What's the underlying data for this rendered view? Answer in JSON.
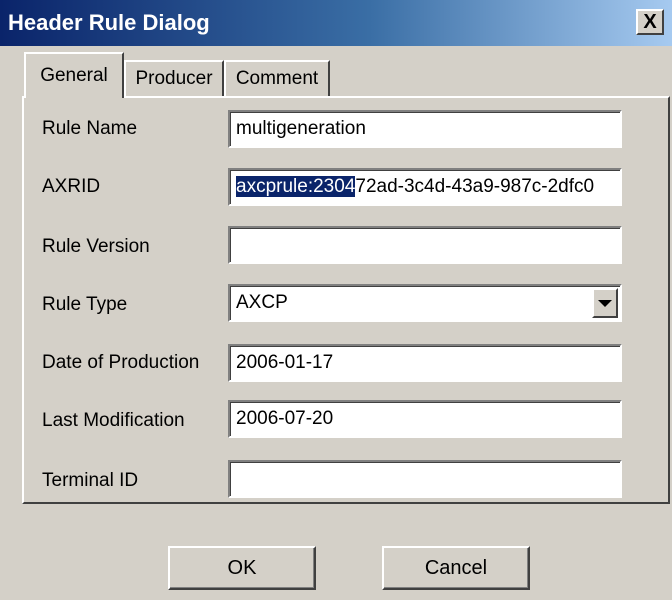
{
  "window": {
    "title": "Header Rule Dialog",
    "close_glyph": "X"
  },
  "tabs": [
    {
      "label": "General",
      "active": true
    },
    {
      "label": "Producer",
      "active": false
    },
    {
      "label": "Comment",
      "active": false
    }
  ],
  "form": {
    "rule_name": {
      "label": "Rule Name",
      "value": "multigeneration"
    },
    "axrid": {
      "label": "AXRID",
      "value_selected": "axcprule:2304",
      "value_rest": "72ad-3c4d-43a9-987c-2dfc0"
    },
    "rule_version": {
      "label": "Rule Version",
      "value": ""
    },
    "rule_type": {
      "label": "Rule Type",
      "value": "AXCP"
    },
    "date_of_production": {
      "label": "Date of Production",
      "value": "2006-01-17"
    },
    "last_modification": {
      "label": "Last Modification",
      "value": "2006-07-20"
    },
    "terminal_id": {
      "label": "Terminal ID",
      "value": ""
    }
  },
  "buttons": {
    "ok": "OK",
    "cancel": "Cancel"
  },
  "icons": {
    "close": "close-icon",
    "dropdown": "chevron-down-icon"
  },
  "colors": {
    "titlebar_start": "#0a246a",
    "titlebar_end": "#a6caf0",
    "window_bg": "#d4d0c8",
    "selection_bg": "#0a246a"
  }
}
